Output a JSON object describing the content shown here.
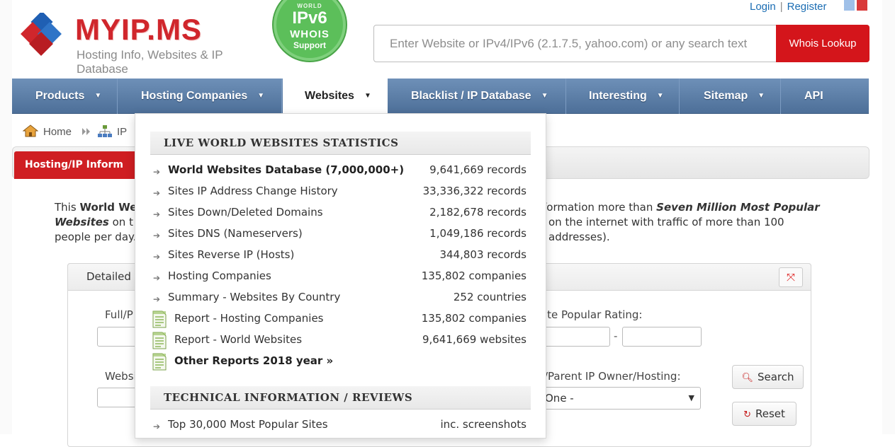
{
  "brand": {
    "name": "MYIP.MS",
    "tagline": "Hosting Info, Websites & IP Database",
    "badge": {
      "top": "WORLD",
      "title": "IPv6",
      "line2": "WHOIS",
      "line3": "Support"
    }
  },
  "auth": {
    "login": "Login",
    "separator": "|",
    "register": "Register"
  },
  "search": {
    "placeholder": "Enter Website or IPv4/IPv6 (2.1.7.5, yahoo.com) or any search text",
    "button": "Whois Lookup"
  },
  "nav": {
    "items": [
      {
        "label": "Products",
        "caret": "▼"
      },
      {
        "label": "Hosting Companies",
        "caret": "▼"
      },
      {
        "label": "Websites",
        "caret": "▼"
      },
      {
        "label": "Blacklist / IP Database",
        "caret": "▼"
      },
      {
        "label": "Interesting",
        "caret": "▼"
      },
      {
        "label": "Sitemap",
        "caret": "▼"
      },
      {
        "label": "API",
        "caret": ""
      }
    ]
  },
  "breadcrumb": {
    "home": "Home",
    "ip": "IP"
  },
  "section": {
    "tab": "Hosting/IP Inform"
  },
  "intro": {
    "line1_pre": "This",
    "line1_bold": "World We",
    "line1_post": "formation more than",
    "line1_em": "Seven Million Most Popular",
    "line2_em": "Websites",
    "line2_pre": "on t",
    "line2_post": "on the internet with traffic of more than 100",
    "line3_pre": "people per day.",
    "line3_post": "addresses)."
  },
  "panel": {
    "header": "Detailed",
    "labels": {
      "full": "Full/P",
      "rating": "ite Popular Rating:",
      "website": "Websi",
      "owner": "/Parent IP Owner/Hosting:"
    },
    "select_value": "One -",
    "dash": "-",
    "search_button": "Search",
    "reset_button": "Reset",
    "expand_icon": "⤧"
  },
  "dropdown": {
    "section1": "LIVE WORLD WEBSITES STATISTICS",
    "rows": [
      {
        "label": "World Websites Database (7,000,000+)",
        "value": "9,641,669 records",
        "bold": true,
        "icon": "arrow"
      },
      {
        "label": "Sites IP Address Change History",
        "value": "33,336,322 records",
        "icon": "arrow"
      },
      {
        "label": "Sites Down/Deleted Domains",
        "value": "2,182,678 records",
        "icon": "arrow"
      },
      {
        "label": "Sites DNS (Nameservers)",
        "value": "1,049,186 records",
        "icon": "arrow"
      },
      {
        "label": "Sites Reverse IP (Hosts)",
        "value": "344,803 records",
        "icon": "arrow"
      },
      {
        "label": "Hosting Companies",
        "value": "135,802 companies",
        "icon": "arrow"
      },
      {
        "label": "Summary - Websites By Country",
        "value": "252 countries",
        "icon": "arrow"
      },
      {
        "label": "Report - Hosting Companies",
        "value": "135,802 companies",
        "icon": "doc"
      },
      {
        "label": "Report - World Websites",
        "value": "9,641,669 websites",
        "icon": "doc"
      },
      {
        "label": "Other Reports 2018 year »",
        "value": "",
        "bold": true,
        "icon": "doc"
      }
    ],
    "section2": "TECHNICAL INFORMATION / REVIEWS",
    "rows2": [
      {
        "label": "Top 30,000 Most Popular Sites",
        "value": "inc. screenshots",
        "icon": "arrow"
      }
    ]
  },
  "colors": {
    "brand_red": "#d0262c",
    "nav_blue": "#5a7ca6",
    "link_blue": "#1b6db3",
    "badge_green": "#5cbf5a"
  }
}
